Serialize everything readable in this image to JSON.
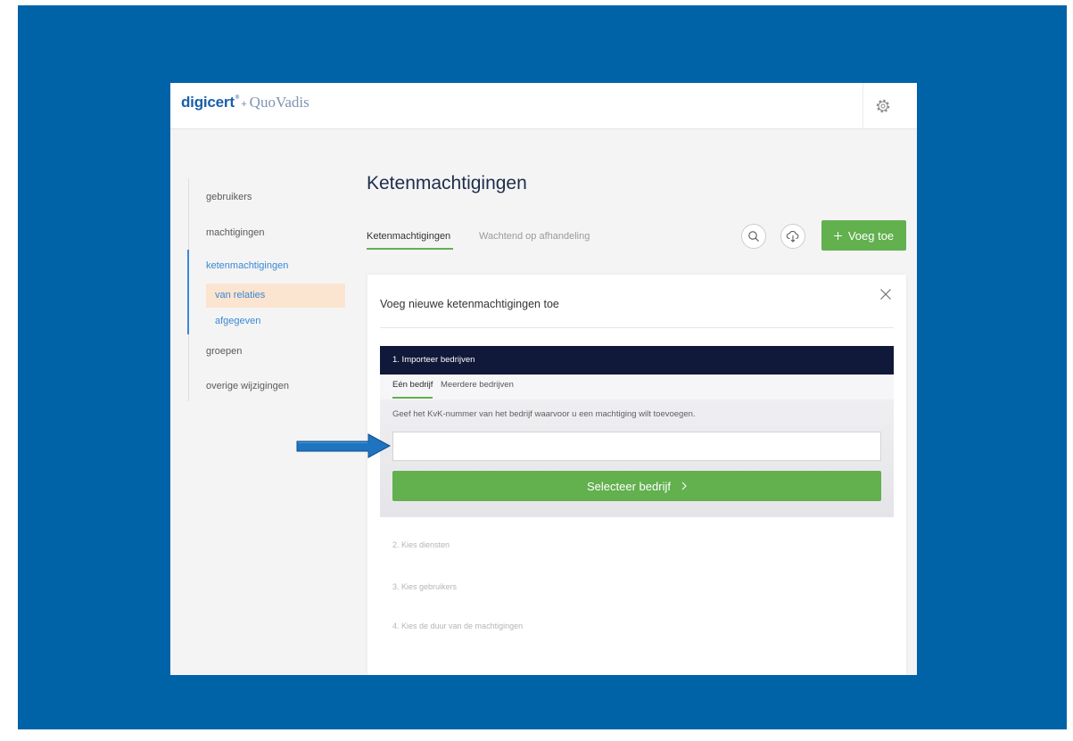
{
  "colors": {
    "backdrop": "#0063a8",
    "accent_green": "#62b04e",
    "nav_active": "#3a88d4",
    "step_header": "#10193a",
    "highlight": "#fbe4d0",
    "arrow": "#1f74bf",
    "title": "#1e2d4a",
    "logo_primary": "#1a5fa8",
    "logo_secondary": "#8094b1"
  },
  "header": {
    "logo_primary": "digicert",
    "logo_mark": "®",
    "logo_plus": "+",
    "logo_secondary": "QuoVadis",
    "settings_icon": "gear-icon"
  },
  "sidebar": {
    "items": [
      {
        "label": "gebruikers"
      },
      {
        "label": "machtigingen"
      },
      {
        "label": "ketenmachtigingen",
        "active": true,
        "children": [
          {
            "label": "van relaties",
            "selected": true
          },
          {
            "label": "afgegeven",
            "selected": false
          }
        ]
      },
      {
        "label": "groepen"
      },
      {
        "label": "overige wijzigingen"
      }
    ]
  },
  "main": {
    "title": "Ketenmachtigingen",
    "tabs": [
      {
        "label": "Ketenmachtigingen",
        "active": true
      },
      {
        "label": "Wachtend op afhandeling",
        "active": false
      }
    ],
    "toolbar": {
      "search_icon": "search-icon",
      "download_icon": "cloud-download-icon",
      "add_icon": "plus-icon",
      "add_label": "Voeg toe"
    }
  },
  "dialog": {
    "title": "Voeg nieuwe ketenmachtigingen toe",
    "close_icon": "close-icon",
    "steps": [
      {
        "label": "1. Importeer bedrijven",
        "expanded": true
      },
      {
        "label": "2. Kies diensten",
        "expanded": false
      },
      {
        "label": "3. Kies gebruikers",
        "expanded": false
      },
      {
        "label": "4. Kies de duur van de machtigingen",
        "expanded": false
      }
    ],
    "import": {
      "tabs": [
        {
          "label": "Eén bedrijf",
          "active": true
        },
        {
          "label": "Meerdere bedrijven",
          "active": false
        }
      ],
      "instruction": "Geef het KvK-nummer van het bedrijf waarvoor u een machtiging wilt toevoegen.",
      "kvk_value": "",
      "submit_label": "Selecteer bedrijf",
      "submit_icon": "chevron-right-icon"
    }
  },
  "annotation": {
    "icon": "arrow-right-icon"
  }
}
